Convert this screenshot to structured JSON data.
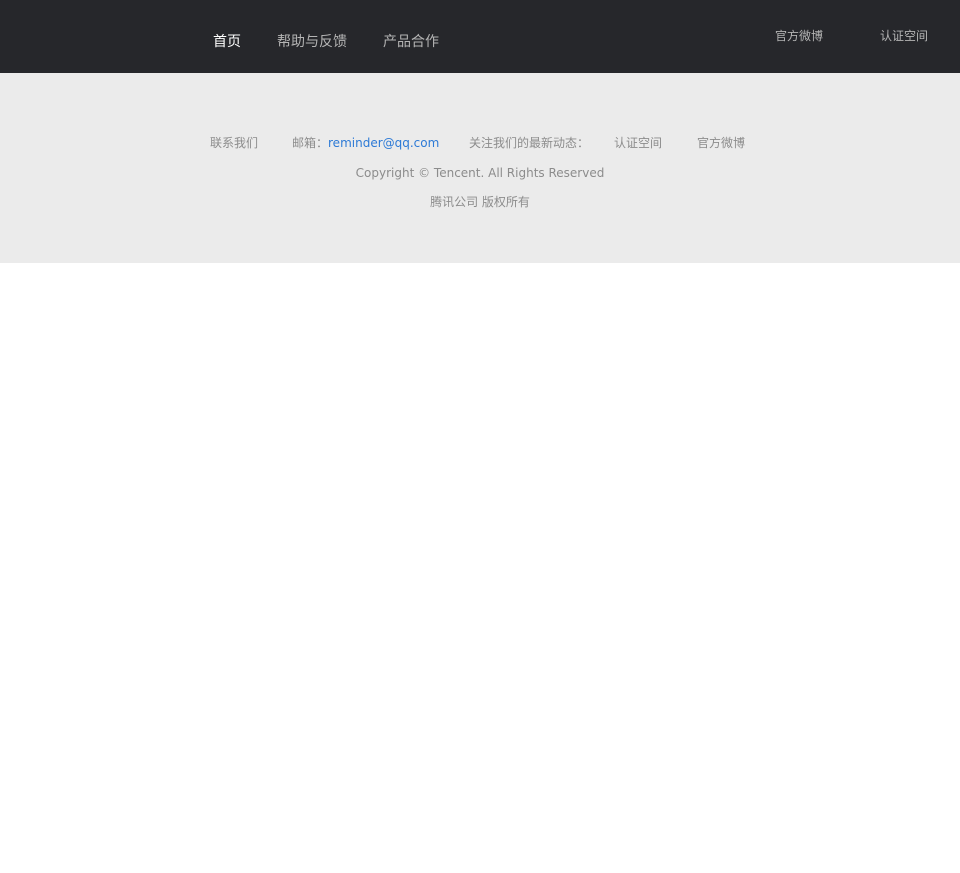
{
  "header": {
    "nav": [
      {
        "label": "首页",
        "active": true
      },
      {
        "label": "帮助与反馈",
        "active": false
      },
      {
        "label": "产品合作",
        "active": false
      }
    ],
    "right_links": [
      {
        "label": "官方微博"
      },
      {
        "label": "认证空间"
      }
    ]
  },
  "footer": {
    "contact_label": "联系我们",
    "email_prefix": "邮箱：",
    "email": "reminder@qq.com",
    "follow_label": "关注我们的最新动态：",
    "follow_links": [
      {
        "label": "认证空间"
      },
      {
        "label": "官方微博"
      }
    ],
    "copyright": "Copyright © Tencent. All Rights Reserved",
    "rights": "腾讯公司 版权所有"
  },
  "colors": {
    "header_bg": "#26272b",
    "footer_bg": "#ebebeb",
    "link_blue": "#2d7ad6",
    "muted_text": "#8c8c8c"
  }
}
